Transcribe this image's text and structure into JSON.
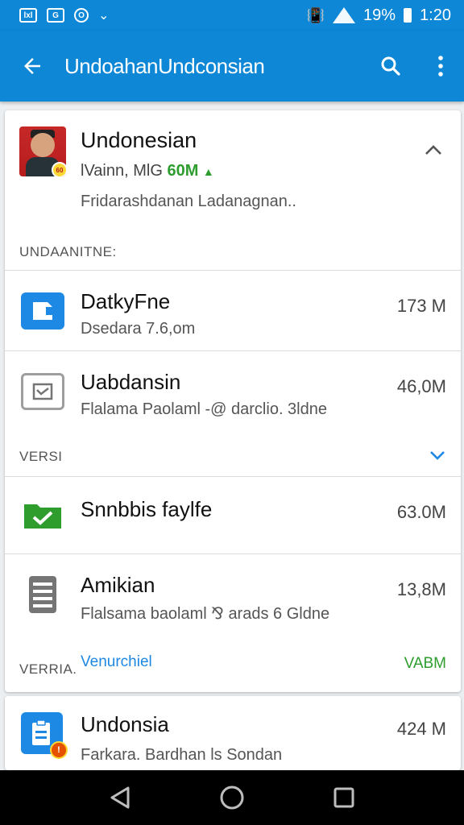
{
  "status_bar": {
    "left_icons": [
      "lxl",
      "G",
      "O"
    ],
    "battery": "19%",
    "time": "1:20"
  },
  "app_bar": {
    "title": "UndoahanUndconsian"
  },
  "header_item": {
    "title": "Undonesian",
    "subtitle_prefix": "lVainn, MlG",
    "subtitle_size": "60M",
    "description": "Fridarashdanan Ladanagnan..",
    "avatar_badge": "60"
  },
  "section_1_label": "UNDAANITNE:",
  "items": [
    {
      "title": "DatkyFne",
      "subtitle": "Dsedara 7.6,om",
      "size": "173 M"
    },
    {
      "title": "Uabdansin",
      "subtitle": "Flalama Paolaml -@ darclio. 3ldne",
      "size": "46,0M"
    }
  ],
  "section_2_label": "VERSI",
  "items_2": [
    {
      "title": "Snnbbis faylfe",
      "size": "63.0M"
    },
    {
      "title": "Amikian",
      "subtitle": "Flalsama baolaml ⅋ arads 6 Gldne",
      "size": "13,8M"
    }
  ],
  "section_3_label": "VERRIA.",
  "section_3_link": "Venurchiel",
  "section_3_size": "VABM",
  "last_item": {
    "title": "Undonsia",
    "subtitle": "Farkara. Bardhan ls Sondan",
    "size": "424 M"
  },
  "colors": {
    "primary": "#0d87d6",
    "accent_green": "#2e9d2e",
    "link_blue": "#1e88e5"
  }
}
